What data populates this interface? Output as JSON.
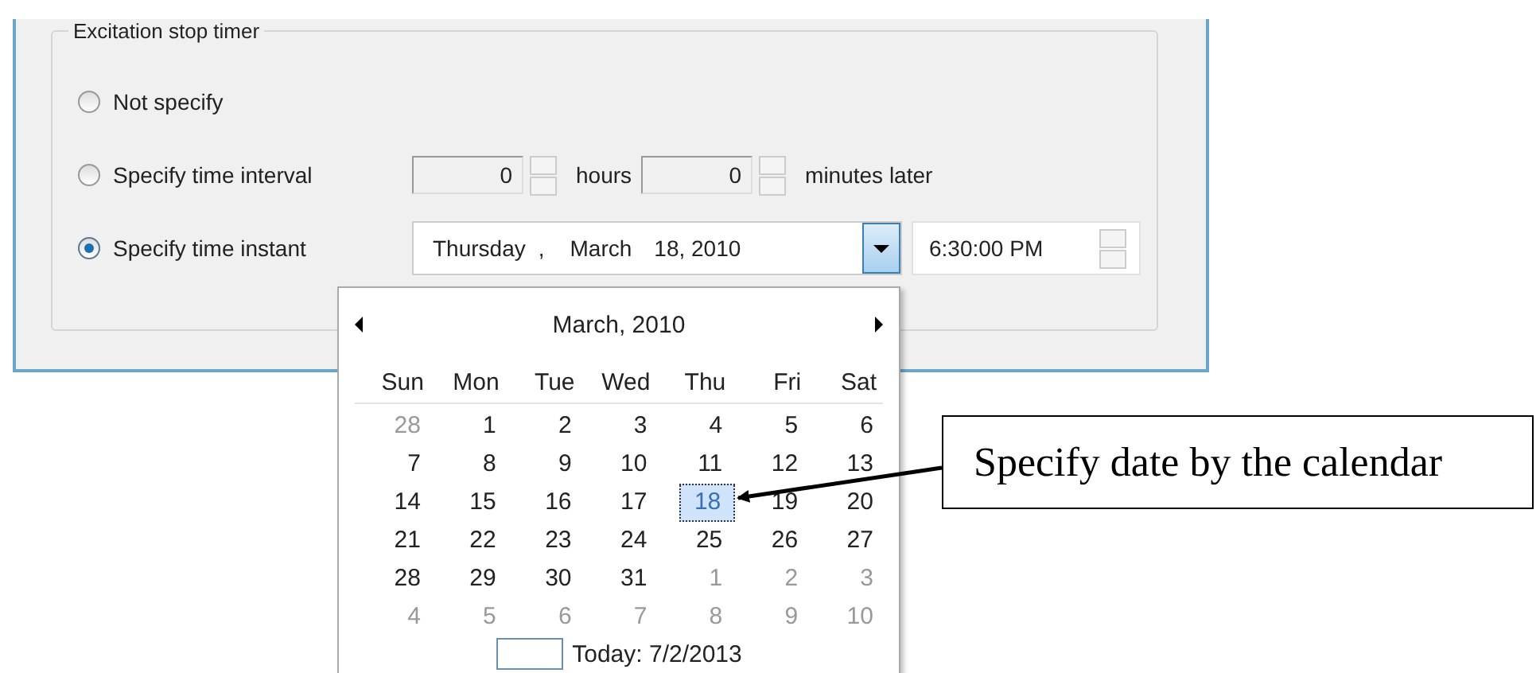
{
  "group": {
    "title": "Excitation stop timer"
  },
  "options": [
    {
      "kind": "plain",
      "label": "Not specify",
      "selected": false
    },
    {
      "kind": "interval",
      "label": "Specify time interval",
      "selected": false,
      "hours": "0",
      "hours_label": "hours",
      "minutes": "0",
      "minutes_label": "minutes later"
    },
    {
      "kind": "instant",
      "label": "Specify time instant",
      "selected": true,
      "date_parts": [
        "Thursday",
        ",",
        "March",
        "18, 2010"
      ],
      "time": "6:30:00 PM"
    }
  ],
  "calendar": {
    "month": "March, 2010",
    "weekdays": [
      "Sun",
      "Mon",
      "Tue",
      "Wed",
      "Thu",
      "Fri",
      "Sat"
    ],
    "weeks": [
      [
        {
          "d": "28",
          "other": true,
          "selected": false
        },
        {
          "d": "1",
          "other": false,
          "selected": false
        },
        {
          "d": "2",
          "other": false,
          "selected": false
        },
        {
          "d": "3",
          "other": false,
          "selected": false
        },
        {
          "d": "4",
          "other": false,
          "selected": false
        },
        {
          "d": "5",
          "other": false,
          "selected": false
        },
        {
          "d": "6",
          "other": false,
          "selected": false
        }
      ],
      [
        {
          "d": "7",
          "other": false,
          "selected": false
        },
        {
          "d": "8",
          "other": false,
          "selected": false
        },
        {
          "d": "9",
          "other": false,
          "selected": false
        },
        {
          "d": "10",
          "other": false,
          "selected": false
        },
        {
          "d": "11",
          "other": false,
          "selected": false
        },
        {
          "d": "12",
          "other": false,
          "selected": false
        },
        {
          "d": "13",
          "other": false,
          "selected": false
        }
      ],
      [
        {
          "d": "14",
          "other": false,
          "selected": false
        },
        {
          "d": "15",
          "other": false,
          "selected": false
        },
        {
          "d": "16",
          "other": false,
          "selected": false
        },
        {
          "d": "17",
          "other": false,
          "selected": false
        },
        {
          "d": "18",
          "other": false,
          "selected": true
        },
        {
          "d": "19",
          "other": false,
          "selected": false
        },
        {
          "d": "20",
          "other": false,
          "selected": false
        }
      ],
      [
        {
          "d": "21",
          "other": false,
          "selected": false
        },
        {
          "d": "22",
          "other": false,
          "selected": false
        },
        {
          "d": "23",
          "other": false,
          "selected": false
        },
        {
          "d": "24",
          "other": false,
          "selected": false
        },
        {
          "d": "25",
          "other": false,
          "selected": false
        },
        {
          "d": "26",
          "other": false,
          "selected": false
        },
        {
          "d": "27",
          "other": false,
          "selected": false
        }
      ],
      [
        {
          "d": "28",
          "other": false,
          "selected": false
        },
        {
          "d": "29",
          "other": false,
          "selected": false
        },
        {
          "d": "30",
          "other": false,
          "selected": false
        },
        {
          "d": "31",
          "other": false,
          "selected": false
        },
        {
          "d": "1",
          "other": true,
          "selected": false
        },
        {
          "d": "2",
          "other": true,
          "selected": false
        },
        {
          "d": "3",
          "other": true,
          "selected": false
        }
      ],
      [
        {
          "d": "4",
          "other": true,
          "selected": false
        },
        {
          "d": "5",
          "other": true,
          "selected": false
        },
        {
          "d": "6",
          "other": true,
          "selected": false
        },
        {
          "d": "7",
          "other": true,
          "selected": false
        },
        {
          "d": "8",
          "other": true,
          "selected": false
        },
        {
          "d": "9",
          "other": true,
          "selected": false
        },
        {
          "d": "10",
          "other": true,
          "selected": false
        }
      ]
    ],
    "today": "Today: 7/2/2013"
  },
  "callout": {
    "text": "Specify date by the calendar"
  }
}
